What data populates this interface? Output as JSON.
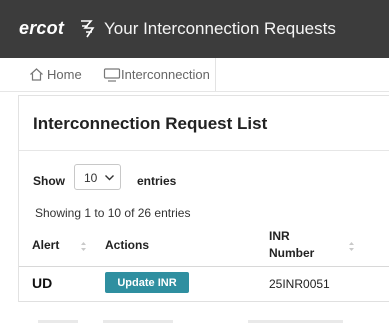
{
  "header": {
    "logo": "ercot",
    "title": "Your Interconnection Requests"
  },
  "breadcrumb": {
    "home": "Home",
    "interconnection": "Interconnection"
  },
  "panel": {
    "title": "Interconnection Request List",
    "show_label": "Show",
    "entries_value": "10",
    "entries_label": "entries",
    "info": "Showing 1 to 10 of 26 entries"
  },
  "table": {
    "columns": [
      "Alert",
      "Actions",
      "INR\nNumber"
    ],
    "col_inr_line1": "INR",
    "col_inr_line2": "Number",
    "rows": [
      {
        "alert": "UD",
        "action": "Update INR",
        "inr": "25INR0051"
      }
    ]
  },
  "colors": {
    "topbar": "#3c3c3c",
    "accent_button": "#2f8fa0"
  }
}
